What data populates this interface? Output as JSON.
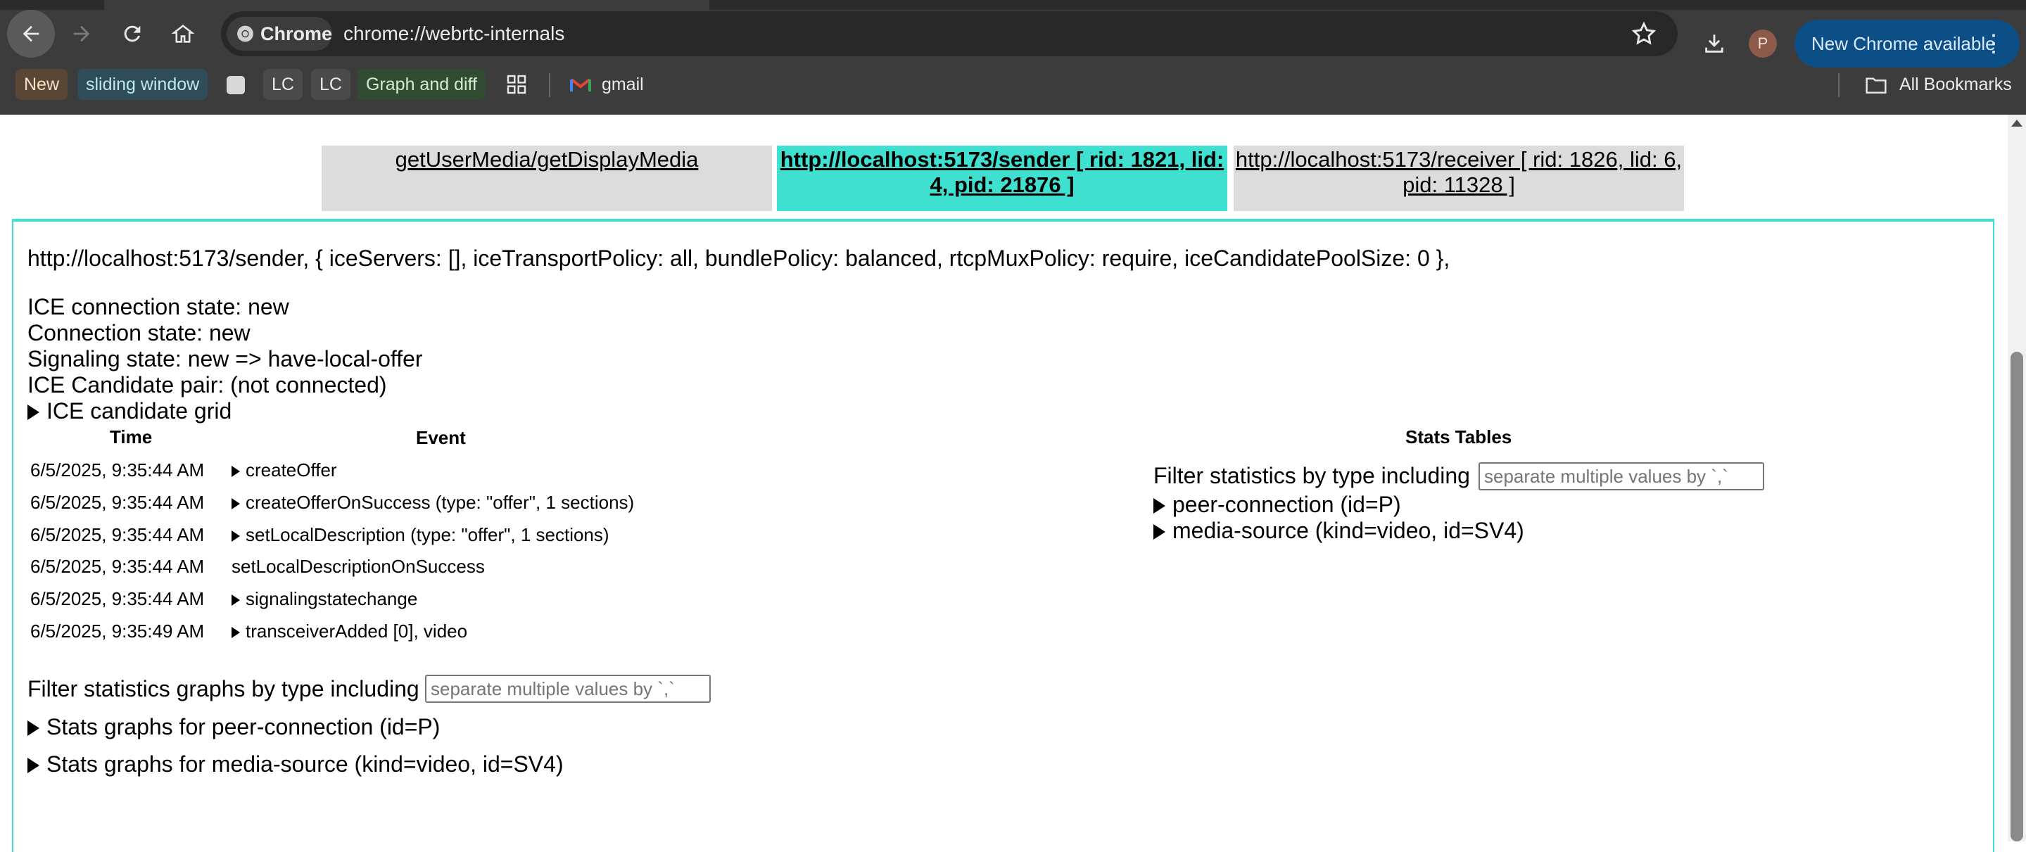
{
  "browser": {
    "url": "chrome://webrtc-internals",
    "chip_label": "Chrome",
    "profile_initial": "P",
    "update_label": "New Chrome available",
    "update_dots": "⋮"
  },
  "bookmarks": {
    "items": [
      "New",
      "sliding window",
      "LC",
      "LC",
      "Graph and diff",
      "gmail"
    ],
    "all_bookmarks": "All Bookmarks"
  },
  "tabs": [
    {
      "label": "getUserMedia/getDisplayMedia",
      "active": false
    },
    {
      "label": "http://localhost:5173/sender [ rid: 1821, lid: 4, pid: 21876 ]",
      "active": true
    },
    {
      "label": "http://localhost:5173/receiver [ rid: 1826, lid: 6, pid: 11328 ]",
      "active": false
    }
  ],
  "connection": {
    "config": "http://localhost:5173/sender, { iceServers: [], iceTransportPolicy: all, bundlePolicy: balanced, rtcpMuxPolicy: require, iceCandidatePoolSize: 0 },",
    "ice_state": "ICE connection state: new",
    "conn_state": "Connection state: new",
    "signaling_state": "Signaling state: new => have-local-offer",
    "candidate_pair": "ICE Candidate pair: (not connected)",
    "ice_grid": "ICE candidate grid"
  },
  "events": {
    "time_header": "Time",
    "event_header": "Event",
    "rows": [
      {
        "time": "6/5/2025, 9:35:44 AM",
        "event": "createOffer",
        "expandable": true
      },
      {
        "time": "6/5/2025, 9:35:44 AM",
        "event": "createOfferOnSuccess (type: \"offer\", 1 sections)",
        "expandable": true
      },
      {
        "time": "6/5/2025, 9:35:44 AM",
        "event": "setLocalDescription (type: \"offer\", 1 sections)",
        "expandable": true
      },
      {
        "time": "6/5/2025, 9:35:44 AM",
        "event": "setLocalDescriptionOnSuccess",
        "expandable": false
      },
      {
        "time": "6/5/2025, 9:35:44 AM",
        "event": "signalingstatechange",
        "expandable": true
      },
      {
        "time": "6/5/2025, 9:35:49 AM",
        "event": "transceiverAdded [0], video",
        "expandable": true
      }
    ]
  },
  "graphs": {
    "filter_label": "Filter statistics graphs by type including",
    "filter_placeholder": "separate multiple values by `,`",
    "items": [
      "Stats graphs for peer-connection (id=P)",
      "Stats graphs for media-source (kind=video, id=SV4)"
    ]
  },
  "stats_tables": {
    "title": "Stats Tables",
    "filter_label": "Filter statistics by type including",
    "filter_placeholder": "separate multiple values by `,`",
    "items": [
      "peer-connection (id=P)",
      "media-source (kind=video, id=SV4)"
    ]
  }
}
